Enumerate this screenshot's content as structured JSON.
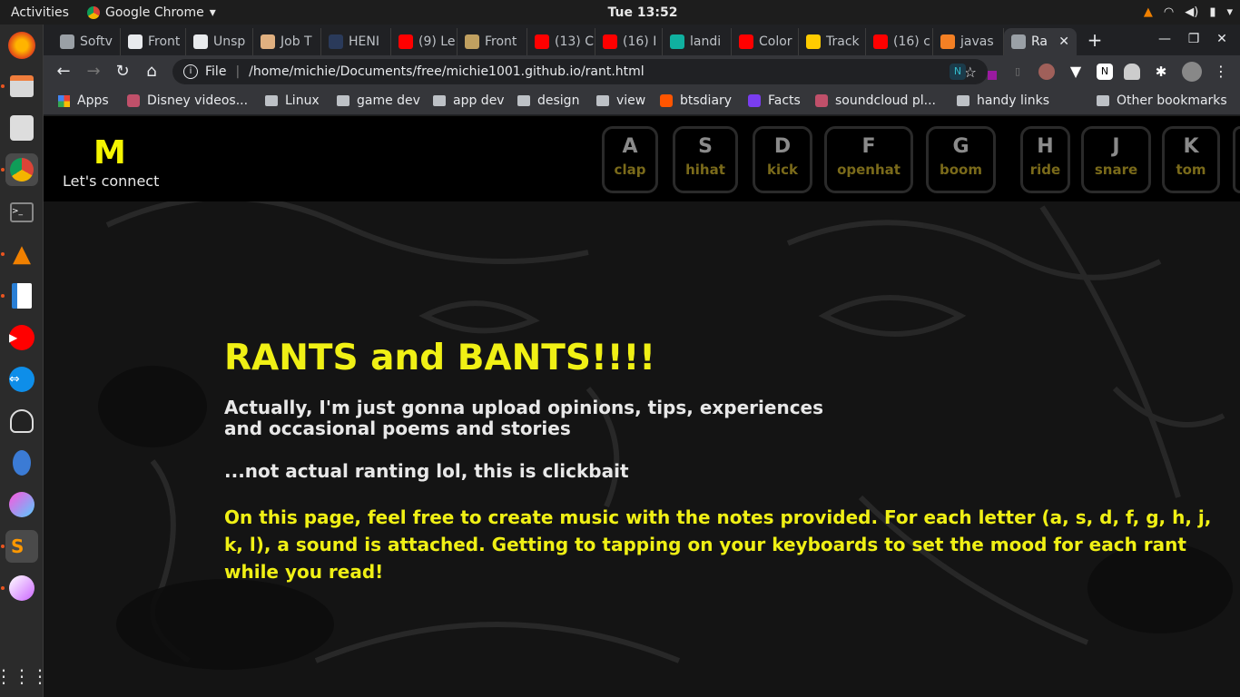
{
  "topbar": {
    "activities": "Activities",
    "app_name": "Google Chrome",
    "clock": "Tue 13:52"
  },
  "browser": {
    "tabs": [
      {
        "label": "Softv",
        "color": "#9aa0a6"
      },
      {
        "label": "Front",
        "color": "#e8eaed"
      },
      {
        "label": "Unsp",
        "color": "#e8eaed"
      },
      {
        "label": "Job T",
        "color": "#e0b080"
      },
      {
        "label": "HENI",
        "color": "#2a3a5a"
      },
      {
        "label": "(9) Le",
        "color": "#ff0000"
      },
      {
        "label": "Front",
        "color": "#c0a060"
      },
      {
        "label": "(13) C",
        "color": "#ff0000"
      },
      {
        "label": "(16) I",
        "color": "#ff0000"
      },
      {
        "label": "landi",
        "color": "#10b0a0"
      },
      {
        "label": "Color",
        "color": "#ff0000"
      },
      {
        "label": "Track",
        "color": "#ffcc00"
      },
      {
        "label": "(16) c",
        "color": "#ff0000"
      },
      {
        "label": "javas",
        "color": "#f48024"
      },
      {
        "label": "Ra",
        "color": "#9aa0a6"
      }
    ],
    "address": {
      "scheme": "File",
      "url": "/home/michie/Documents/free/michie1001.github.io/rant.html"
    },
    "bookmarks": [
      {
        "label": "Apps",
        "type": "apps"
      },
      {
        "label": "Disney videos...",
        "type": "site"
      },
      {
        "label": "Linux",
        "type": "folder"
      },
      {
        "label": "game dev",
        "type": "folder"
      },
      {
        "label": "app dev",
        "type": "folder"
      },
      {
        "label": "design",
        "type": "folder"
      },
      {
        "label": "view",
        "type": "folder"
      },
      {
        "label": "btsdiary",
        "type": "site"
      },
      {
        "label": "Facts",
        "type": "site"
      },
      {
        "label": "soundcloud pl...",
        "type": "site"
      },
      {
        "label": "handy links",
        "type": "folder"
      },
      {
        "label": "Other bookmarks",
        "type": "folder"
      }
    ]
  },
  "site": {
    "logo": "M",
    "tagline": "Let's connect",
    "drum_keys": [
      {
        "key": "A",
        "sound": "clap"
      },
      {
        "key": "S",
        "sound": "hihat"
      },
      {
        "key": "D",
        "sound": "kick"
      },
      {
        "key": "F",
        "sound": "openhat"
      },
      {
        "key": "G",
        "sound": "boom"
      },
      {
        "key": "H",
        "sound": "ride"
      },
      {
        "key": "J",
        "sound": "snare"
      },
      {
        "key": "K",
        "sound": "tom"
      }
    ],
    "title": "RANTS and BANTS!!!!",
    "subtitle": "Actually, I'm just gonna upload opinions, tips, experiences and occasional poems and stories",
    "note": "...not actual ranting lol, this is clickbait",
    "instructions": "On this page, feel free to create music with the notes provided. For each letter (a, s, d, f, g, h, j, k, l), a sound is attached. Getting to tapping on your keyboards to set the mood for each rant while you read!"
  },
  "colors": {
    "accent_yellow": "#f0f015",
    "page_bg": "#141414",
    "chrome_dark": "#202124",
    "chrome_toolbar": "#35363a"
  }
}
